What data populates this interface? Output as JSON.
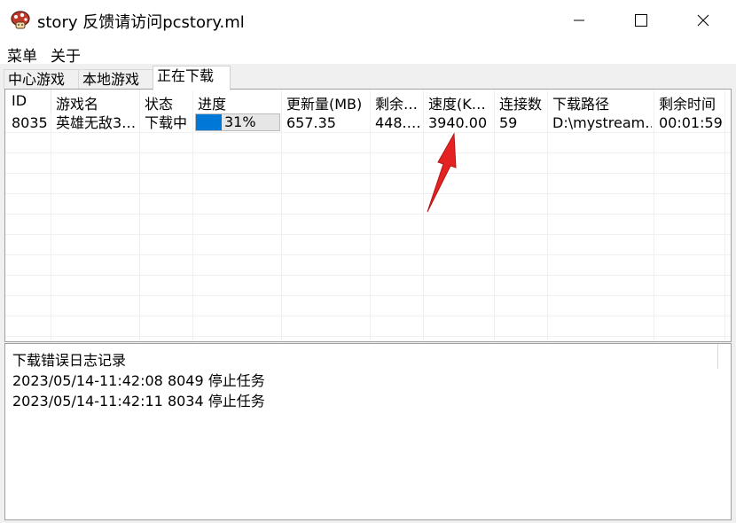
{
  "window": {
    "title": "story 反馈请访问pcstory.ml",
    "minimize_glyph": "—",
    "maximize_glyph": "☐",
    "close_glyph": "✕"
  },
  "menu": {
    "items": [
      "菜单",
      "关于"
    ]
  },
  "tabs": {
    "items": [
      "中心游戏",
      "本地游戏",
      "正在下载"
    ],
    "active_index": 2
  },
  "table": {
    "headers": [
      "ID",
      "游戏名",
      "状态",
      "进度",
      "更新量(MB)",
      "剩余…",
      "速度(K…",
      "连接数",
      "下载路径",
      "剩余时间"
    ],
    "rows": [
      {
        "id": "8035",
        "name": "英雄无敌3…",
        "status": "下载中",
        "progress_percent": 31,
        "progress_label": "31%",
        "update_mb": "657.35",
        "remaining": "448.…",
        "speed": "3940.00",
        "connections": "59",
        "path": "D:\\mystream…",
        "time_left": "00:01:59"
      }
    ]
  },
  "log": {
    "title": "下载错误日志记录",
    "lines": [
      "2023/05/14-11:42:08 8049 停止任务",
      "2023/05/14-11:42:11 8034 停止任务"
    ]
  },
  "colors": {
    "progress_fill": "#0078d7",
    "annotation_arrow": "#e52222"
  }
}
